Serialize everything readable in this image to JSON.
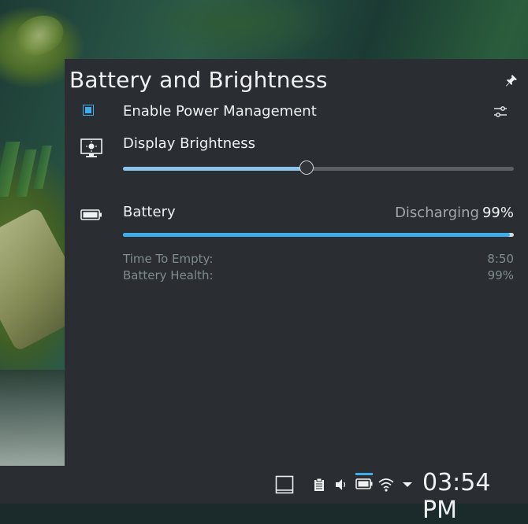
{
  "panel": {
    "title": "Battery and Brightness",
    "power_management": {
      "label": "Enable Power Management",
      "checked": true
    },
    "brightness": {
      "label": "Display Brightness",
      "level_percent": 47
    },
    "battery": {
      "label": "Battery",
      "state": "Discharging",
      "percent_text": "99%",
      "charge_percent": 99,
      "details": [
        {
          "key": "Time To Empty:",
          "value": "8:50"
        },
        {
          "key": "Battery Health:",
          "value": "99%"
        }
      ]
    }
  },
  "taskbar": {
    "clock": "03:54 PM",
    "icons": [
      "show-desktop-icon",
      "clipboard-icon",
      "volume-icon",
      "battery-tray-icon",
      "wifi-icon",
      "expand-tray-arrow-icon"
    ]
  },
  "colors": {
    "accent": "#3daee9",
    "panel_bg": "#2a2e32",
    "text": "#eff0f1",
    "muted": "#7f8c8d"
  }
}
